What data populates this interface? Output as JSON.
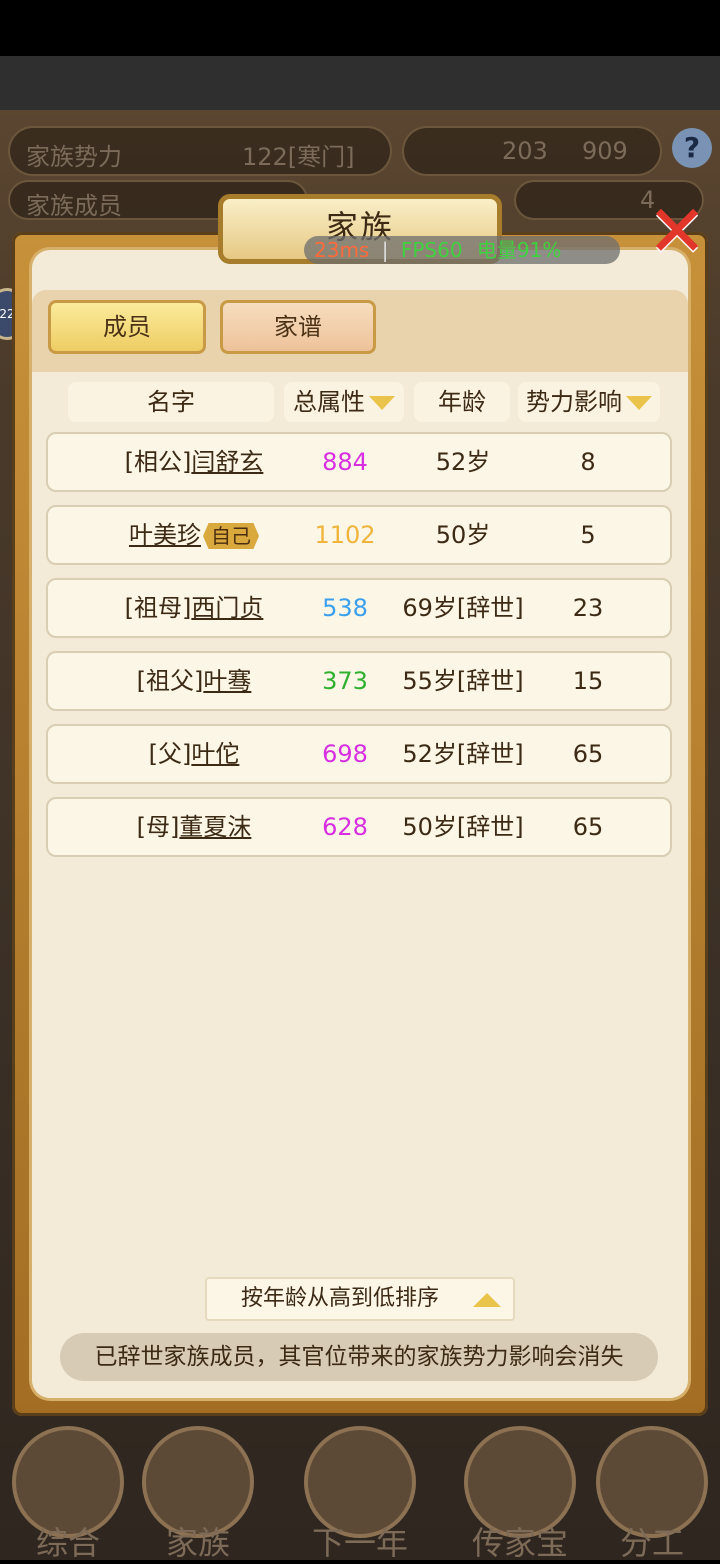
{
  "background": {
    "row1_label": "家族势力",
    "row1_value": "122[寒门]",
    "row1_right": "203",
    "row1_right2": "909",
    "row2_label": "家族成员",
    "row2_right": "4",
    "side_badge": "22"
  },
  "overlay": {
    "ping": "23ms",
    "sep": "|",
    "fps": "FPS60",
    "battery": "电量91%"
  },
  "dialog": {
    "title": "家族",
    "tabs": [
      "成员",
      "家谱"
    ]
  },
  "table": {
    "headers": {
      "name": "名字",
      "attr": "总属性",
      "age": "年龄",
      "influence": "势力影响"
    },
    "rows": [
      {
        "prefix": "[相公]",
        "name": "闫舒玄",
        "attr": "884",
        "attr_color": "#d62ee0",
        "age": "52岁",
        "influence": "8"
      },
      {
        "prefix": "",
        "name": "叶美珍",
        "badge": "自己",
        "attr": "1102",
        "attr_color": "#f0b43a",
        "age": "50岁",
        "influence": "5"
      },
      {
        "prefix": "[祖母]",
        "name": "西门贞",
        "attr": "538",
        "attr_color": "#3aa0ee",
        "age": "69岁[辞世]",
        "influence": "23"
      },
      {
        "prefix": "[祖父]",
        "name": "叶骞",
        "attr": "373",
        "attr_color": "#2fb12f",
        "age": "55岁[辞世]",
        "influence": "15"
      },
      {
        "prefix": "[父]",
        "name": "叶佗",
        "attr": "698",
        "attr_color": "#d62ee0",
        "age": "52岁[辞世]",
        "influence": "65"
      },
      {
        "prefix": "[母]",
        "name": "董夏沫",
        "attr": "628",
        "attr_color": "#d62ee0",
        "age": "50岁[辞世]",
        "influence": "65"
      }
    ]
  },
  "sort_label": "按年龄从高到低排序",
  "notice": "已辞世家族成员，其官位带来的家族势力影响会消失",
  "bottom_nav": [
    "综合",
    "家族",
    "下一年",
    "传家宝",
    "分工"
  ]
}
